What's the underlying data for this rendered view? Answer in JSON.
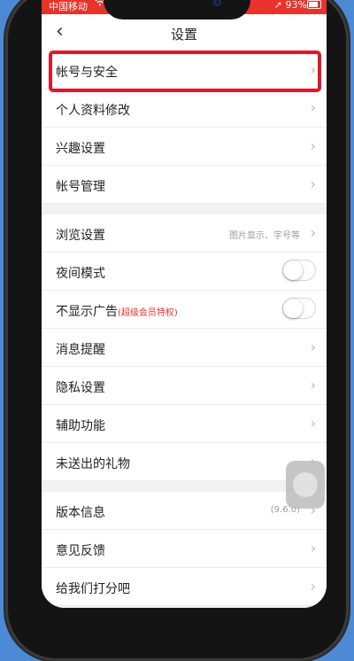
{
  "status_bar": {
    "carrier": "中国移动",
    "battery": "93%",
    "wifi_icon": "wifi-icon",
    "location_icon": "location-arrow-icon"
  },
  "nav": {
    "back_icon": "chevron-left-icon",
    "title": "设置"
  },
  "section1": [
    {
      "label": "帐号与安全"
    },
    {
      "label": "个人资料修改"
    },
    {
      "label": "兴趣设置"
    },
    {
      "label": "帐号管理"
    }
  ],
  "section2": {
    "browse": {
      "label": "浏览设置",
      "hint": "图片显示、字号等"
    },
    "night": {
      "label": "夜间模式",
      "toggle_on": false
    },
    "noads": {
      "label": "不显示广告",
      "badge": "(超级会员特权)",
      "toggle_on": false
    },
    "notify": {
      "label": "消息提醒"
    },
    "privacy": {
      "label": "隐私设置"
    },
    "assist": {
      "label": "辅助功能"
    },
    "gift": {
      "label": "未送出的礼物"
    }
  },
  "section3": {
    "version": {
      "label": "版本信息",
      "hint": "(9.6.0)"
    },
    "feedback": {
      "label": "意见反馈"
    },
    "rate": {
      "label": "给我们打分吧"
    }
  },
  "colors": {
    "status_bar": "#e8322a",
    "highlight_border": "#e2162a",
    "badge": "#e8322a",
    "background": "#4d8ad6"
  }
}
